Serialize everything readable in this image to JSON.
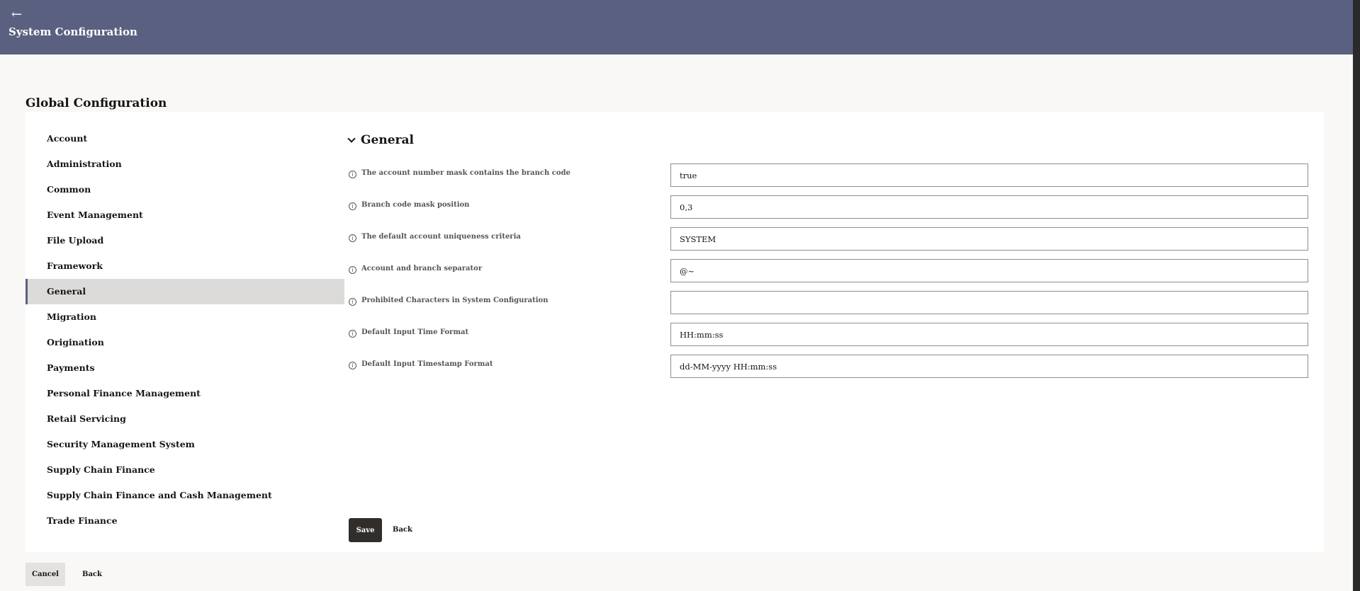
{
  "header": {
    "back_icon": "←",
    "title": "System Configuration",
    "background": "#5a6080"
  },
  "page": {
    "title": "Global Configuration"
  },
  "sidebar": {
    "items": [
      {
        "label": "Account"
      },
      {
        "label": "Administration"
      },
      {
        "label": "Common"
      },
      {
        "label": "Event Management"
      },
      {
        "label": "File Upload"
      },
      {
        "label": "Framework"
      },
      {
        "label": "General",
        "active": true
      },
      {
        "label": "Migration"
      },
      {
        "label": "Origination"
      },
      {
        "label": "Payments"
      },
      {
        "label": "Personal Finance Management"
      },
      {
        "label": "Retail Servicing"
      },
      {
        "label": "Security Management System"
      },
      {
        "label": "Supply Chain Finance"
      },
      {
        "label": "Supply Chain Finance and Cash Management"
      },
      {
        "label": "Trade Finance"
      }
    ]
  },
  "section": {
    "title": "General",
    "fields": [
      {
        "label": "The account number mask contains the branch code",
        "value": "true"
      },
      {
        "label": "Branch code mask position",
        "value": "0,3"
      },
      {
        "label": "The default account uniqueness criteria",
        "value": "SYSTEM"
      },
      {
        "label": "Account and branch separator",
        "value": "@~"
      },
      {
        "label": "Prohibited Characters in System Configuration",
        "value": ""
      },
      {
        "label": "Default Input Time Format",
        "value": "HH:mm:ss"
      },
      {
        "label": "Default Input Timestamp Format",
        "value": "dd-MM-yyyy HH:mm:ss"
      }
    ]
  },
  "actions": {
    "save_label": "Save",
    "back_label": "Back",
    "cancel_label": "Cancel",
    "footer_back_label": "Back"
  },
  "colors": {
    "primary_button": "#312d2a",
    "active_item": "#dcdbda"
  }
}
